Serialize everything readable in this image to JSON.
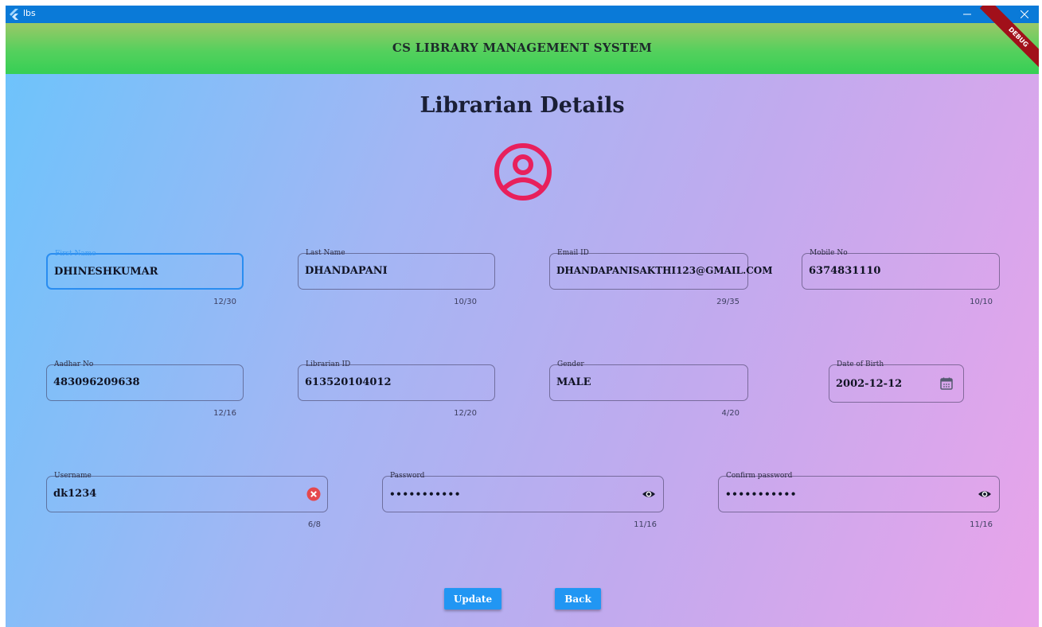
{
  "window": {
    "title": "lbs",
    "icon": "flutter-icon",
    "controls": [
      "minimize-icon",
      "restore-icon",
      "close-icon"
    ]
  },
  "appbar": {
    "title": "CS LIBRARY MANAGEMENT SYSTEM",
    "background": "#4ccf5a"
  },
  "debug_banner": "DEBUG",
  "page": {
    "heading": "Librarian Details",
    "avatar_icon": "account-circle-icon",
    "avatar_color": "#e8205c"
  },
  "fields": {
    "first_name": {
      "label": "First Name",
      "value": "DHINESHKUMAR",
      "counter": "12/30"
    },
    "last_name": {
      "label": "Last Name",
      "value": "DHANDAPANI",
      "counter": "10/30"
    },
    "email": {
      "label": "Email ID",
      "value": "DHANDAPANISAKTHI123@GMAIL.COM",
      "counter": "29/35"
    },
    "mobile": {
      "label": "Mobile No",
      "value": "6374831110",
      "counter": "10/10"
    },
    "aadhar": {
      "label": "Aadhar No",
      "value": "483096209638",
      "counter": "12/16"
    },
    "librarian_id": {
      "label": "Librarian ID",
      "value": "613520104012",
      "counter": "12/20"
    },
    "gender": {
      "label": "Gender",
      "value": "MALE",
      "counter": "4/20"
    },
    "dob": {
      "label": "Date of Birth",
      "value": "2002-12-12",
      "icon": "calendar-icon"
    },
    "username": {
      "label": "Username",
      "value": "dk1234",
      "counter": "6/8",
      "icon": "clear-icon"
    },
    "password": {
      "label": "Password",
      "value": "•••••••••••",
      "counter": "11/16",
      "icon": "eye-icon"
    },
    "confirm_password": {
      "label": "Confirm password",
      "value": "•••••••••••",
      "counter": "11/16",
      "icon": "eye-icon"
    }
  },
  "buttons": {
    "update": "Update",
    "back": "Back"
  },
  "colors": {
    "accent": "#2196f3",
    "titlebar": "#0a7ad8",
    "clear_icon": "#e5484d"
  }
}
